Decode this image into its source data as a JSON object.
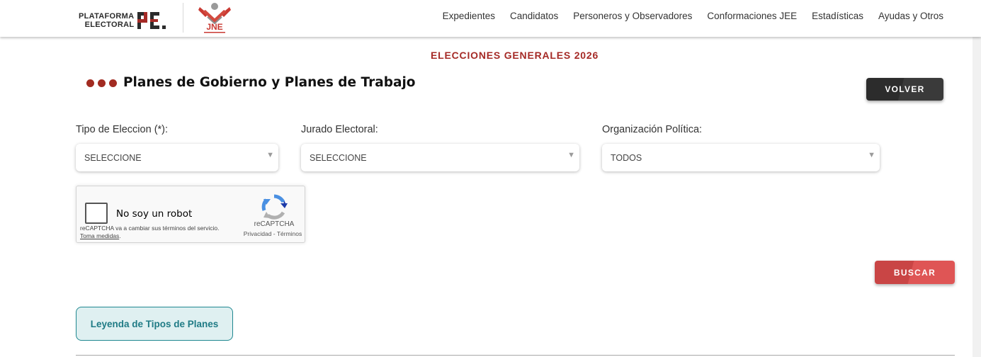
{
  "header": {
    "logo_pe": {
      "line1": "PLATAFORMA",
      "line2": "ELECTORAL",
      "mark": "PE"
    },
    "logo_jne": {
      "text": "JNE"
    },
    "nav": [
      "Expedientes",
      "Candidatos",
      "Personeros y Observadores",
      "Conformaciones JEE",
      "Estadísticas",
      "Ayudas y Otros"
    ]
  },
  "page": {
    "subtitle": "ELECCIONES GENERALES 2026",
    "title": "Planes de Gobierno y Planes de Trabajo",
    "back_label": "VOLVER"
  },
  "filters": {
    "tipo_eleccion": {
      "label": "Tipo de Eleccion (*):",
      "value": "SELECCIONE"
    },
    "jurado_electoral": {
      "label": "Jurado Electoral:",
      "value": "SELECCIONE"
    },
    "organizacion_politica": {
      "label": "Organización Política:",
      "value": "TODOS"
    }
  },
  "captcha": {
    "label": "No soy un robot",
    "notice": "reCAPTCHA va a cambiar sus términos del servicio.",
    "notice_link": "Toma medidas",
    "brand": "reCAPTCHA",
    "links": "Privacidad - Términos"
  },
  "actions": {
    "search_label": "BUSCAR",
    "legend_label": "Leyenda de Tipos de Planes"
  },
  "colors": {
    "accent_red": "#a52a26",
    "dark_button": "#2c2c2c",
    "search_button": "#df5555",
    "legend_teal": "#1f8790"
  }
}
